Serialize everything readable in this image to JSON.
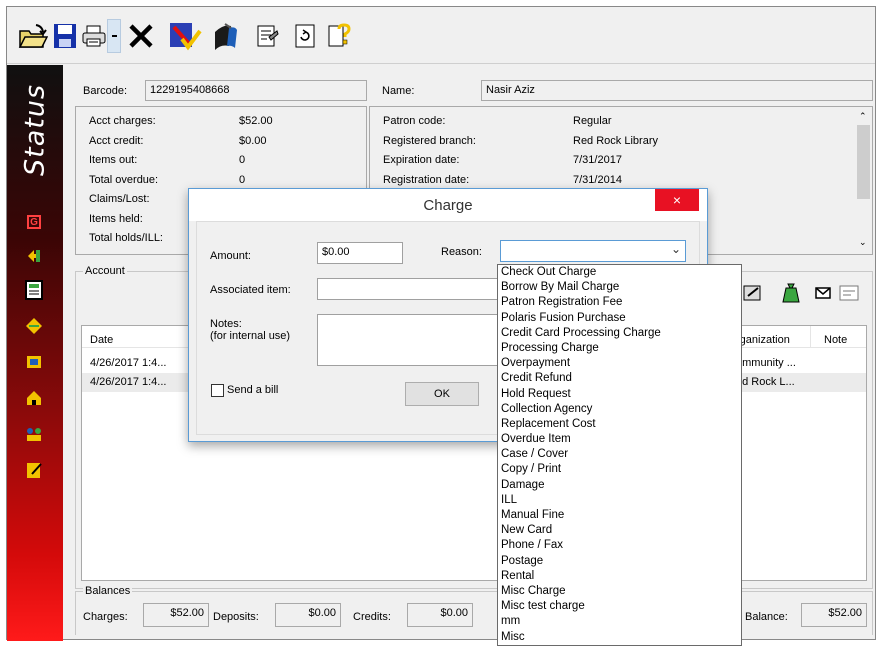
{
  "patron": {
    "barcode_label": "Barcode:",
    "barcode": "1229195408668",
    "name_label": "Name:",
    "name": "Nasir Aziz"
  },
  "summary": [
    {
      "label": "Acct charges:",
      "value": "$52.00"
    },
    {
      "label": "Acct credit:",
      "value": "$0.00"
    },
    {
      "label": "Items out:",
      "value": "0"
    },
    {
      "label": "Total overdue:",
      "value": "0"
    },
    {
      "label": "Claims/Lost:",
      "value": ""
    },
    {
      "label": "Items held:",
      "value": ""
    },
    {
      "label": "Total holds/ILL:",
      "value": ""
    }
  ],
  "details": [
    {
      "label": "Patron code:",
      "value": "Regular"
    },
    {
      "label": "Registered branch:",
      "value": "Red Rock Library"
    },
    {
      "label": "Expiration date:",
      "value": "7/31/2017"
    },
    {
      "label": "Registration date:",
      "value": "7/31/2014"
    }
  ],
  "sidebar": {
    "title": "Status"
  },
  "account": {
    "title": "Account",
    "col_date": "Date",
    "col_organization": "Organization",
    "col_organization_visible": "rganization",
    "col_note": "Note",
    "rows": [
      {
        "date": "4/26/2017 1:4...",
        "organization": "ommunity ..."
      },
      {
        "date": "4/26/2017 1:4...",
        "organization": "ed Rock L..."
      }
    ]
  },
  "balances": {
    "title": "Balances",
    "charges_label": "Charges:",
    "charges": "$52.00",
    "deposits_label": "Deposits:",
    "deposits": "$0.00",
    "credits_label": "Credits:",
    "credits": "$0.00",
    "balance_label": "Balance:",
    "balance": "$52.00"
  },
  "dialog": {
    "title": "Charge",
    "close": "×",
    "amount_label": "Amount:",
    "amount": "$0.00",
    "reason_label": "Reason:",
    "reason_value": "",
    "associated_label": "Associated item:",
    "associated_value": "",
    "notes_label": "Notes:",
    "notes_sub": "(for internal use)",
    "send_bill": "Send a bill",
    "ok": "OK"
  },
  "reasons": [
    "Check Out Charge",
    "Borrow By Mail Charge",
    "Patron Registration Fee",
    "Polaris Fusion Purchase",
    "Credit Card Processing Charge",
    "Processing Charge",
    "Overpayment",
    "Credit Refund",
    "Hold Request",
    "Collection Agency",
    "Replacement Cost",
    "Overdue Item",
    "Case / Cover",
    "Copy / Print",
    "Damage",
    "ILL",
    "Manual Fine",
    "New Card",
    "Phone / Fax",
    "Postage",
    "Rental",
    "Misc Charge",
    "Misc test charge",
    "mm",
    "Misc"
  ],
  "colors": {
    "accent": "#5a9bd5",
    "close": "#e81123",
    "status_top": "#101010",
    "status_bottom": "#ff1a1a"
  }
}
